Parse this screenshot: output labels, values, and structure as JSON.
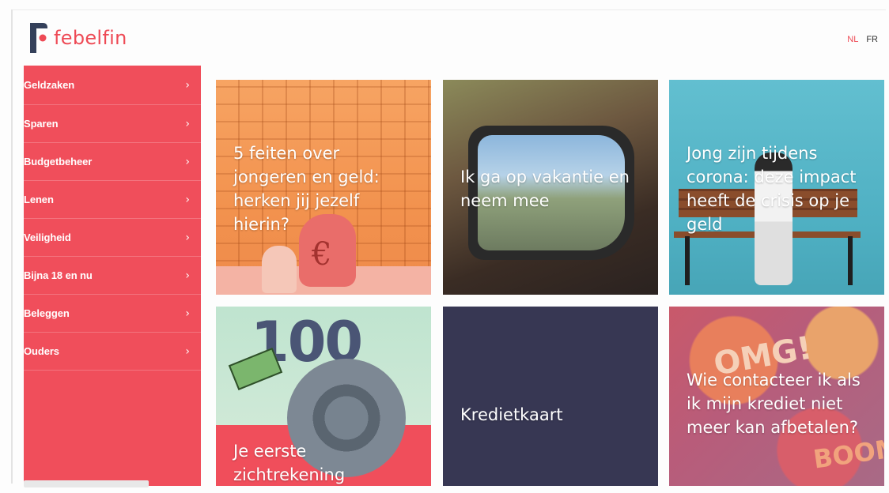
{
  "brand": {
    "name": "febelfin",
    "color": "#ee4a55"
  },
  "lang": {
    "nl": "NL",
    "fr": "FR"
  },
  "sidebar": {
    "items": [
      {
        "label": "Geldzaken"
      },
      {
        "label": "Sparen"
      },
      {
        "label": "Budgetbeheer"
      },
      {
        "label": "Lenen"
      },
      {
        "label": "Veiligheid"
      },
      {
        "label": "Bijna 18 en nu"
      },
      {
        "label": "Beleggen"
      },
      {
        "label": "Ouders"
      }
    ],
    "chevron": "›",
    "background": "#f04e5b"
  },
  "cards": [
    {
      "title": "5 feiten over jongeren en geld: herken jij jezelf hierin?"
    },
    {
      "title": "Ik ga op vakantie en neem mee"
    },
    {
      "title": "Jong zijn tijdens corona: deze impact heeft de crisis op je geld"
    },
    {
      "title": "Je eerste zichtrekening",
      "illustration": {
        "number": "100"
      }
    },
    {
      "title": "Kredietkaart"
    },
    {
      "title": "Wie contacteer ik als ik mijn krediet niet meer kan afbetalen?",
      "illustration": {
        "text1": "OMG!",
        "text2": "BOOM!"
      }
    }
  ]
}
